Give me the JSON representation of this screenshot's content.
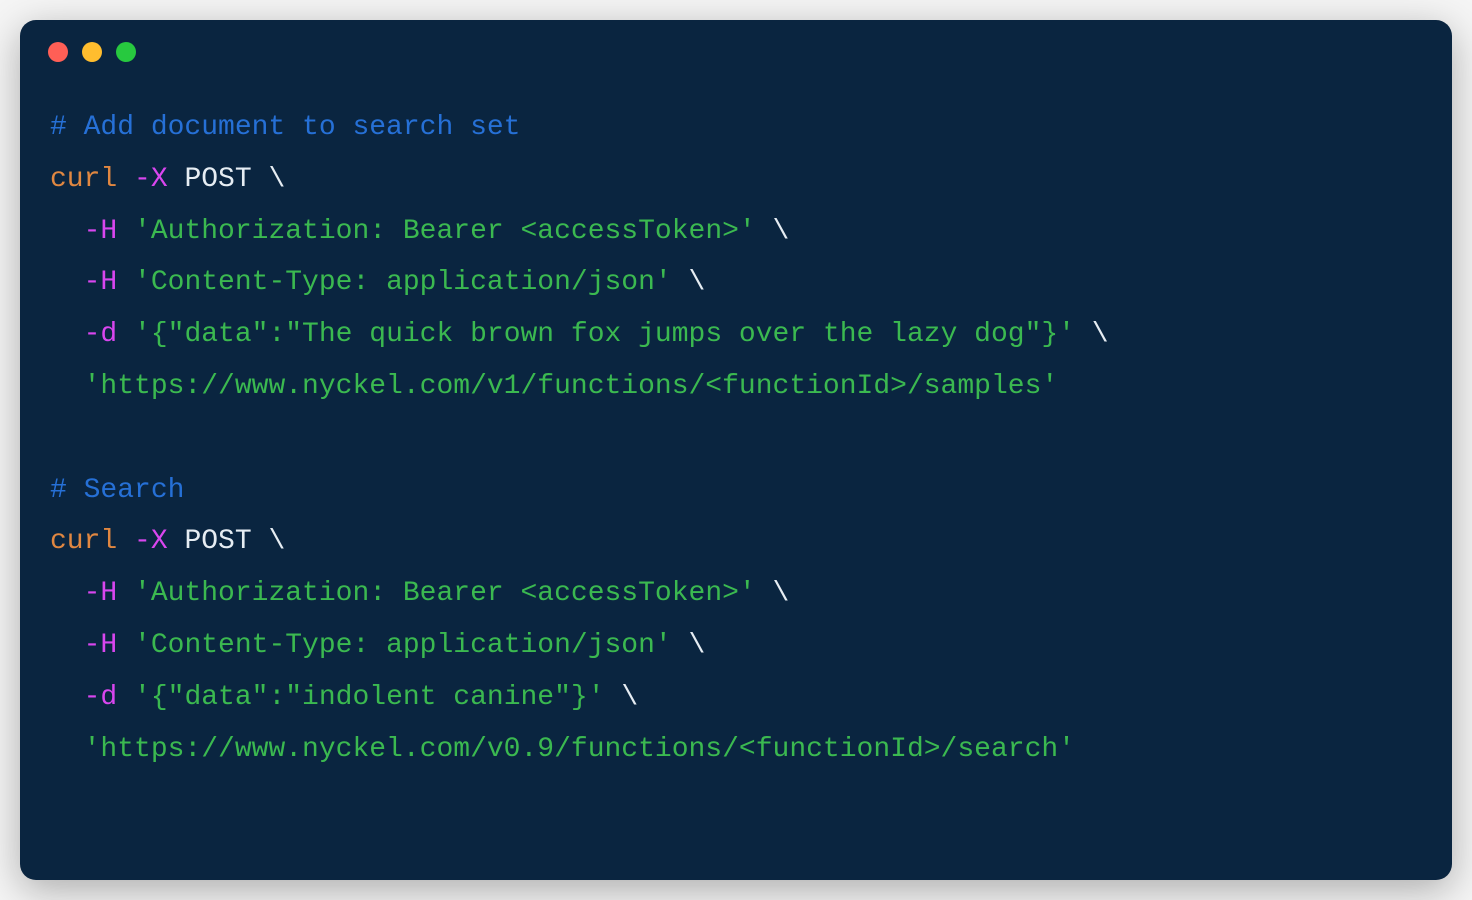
{
  "colors": {
    "background": "#0a2540",
    "comment": "#2670d6",
    "command": "#e08741",
    "flag": "#d946ef",
    "string": "#3bb950",
    "plain": "#e6edf3",
    "close": "#ff5f56",
    "minimize": "#ffbd2e",
    "maximize": "#27c93f"
  },
  "code": {
    "block1": {
      "comment": "# Add document to search set",
      "cmd": "curl",
      "flag_x": "-X",
      "method": "POST",
      "bs": "\\",
      "flag_h": "-H",
      "auth_str": "'Authorization: Bearer <accessToken>'",
      "ct_str": "'Content-Type: application/json'",
      "flag_d": "-d",
      "data_str": "'{\"data\":\"The quick brown fox jumps over the lazy dog\"}'",
      "url_str": "'https://www.nyckel.com/v1/functions/<functionId>/samples'"
    },
    "block2": {
      "comment": "# Search",
      "cmd": "curl",
      "flag_x": "-X",
      "method": "POST",
      "bs": "\\",
      "flag_h": "-H",
      "auth_str": "'Authorization: Bearer <accessToken>'",
      "ct_str": "'Content-Type: application/json'",
      "flag_d": "-d",
      "data_str": "'{\"data\":\"indolent canine\"}'",
      "url_str": "'https://www.nyckel.com/v0.9/functions/<functionId>/search'"
    }
  }
}
